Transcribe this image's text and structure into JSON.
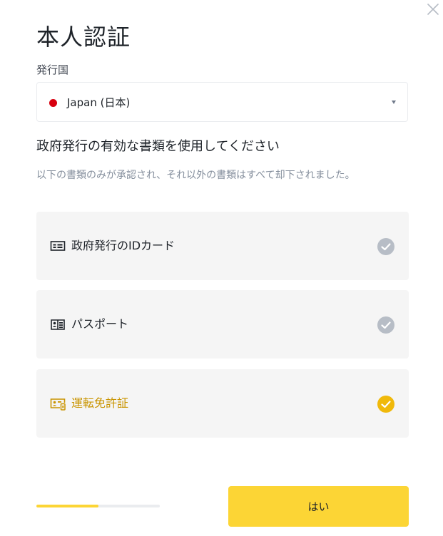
{
  "colors": {
    "accent": "#fcd535",
    "selected_text": "#c99400",
    "check_inactive": "#b7bdc6",
    "check_active": "#f0b90b",
    "flag_japan": "#d7000f",
    "option_bg": "#f5f5f5"
  },
  "dialog": {
    "title": "本人認証",
    "close_icon": "close-icon"
  },
  "issuing_country": {
    "label": "発行国",
    "value": "Japan (日本)",
    "flag_icon": "japan-flag-dot-icon",
    "arrow_icon": "caret-down-icon"
  },
  "documents": {
    "heading": "政府発行の有効な書類を使用してください",
    "description": "以下の書類のみが承認され、それ以外の書類はすべて却下されました。",
    "options": [
      {
        "label": "政府発行のIDカード",
        "icon": "id-card-icon",
        "selected": false
      },
      {
        "label": "パスポート",
        "icon": "passport-icon",
        "selected": false
      },
      {
        "label": "運転免許証",
        "icon": "drivers-license-icon",
        "selected": true
      }
    ]
  },
  "footer": {
    "progress_fraction": 0.5,
    "confirm_label": "はい"
  }
}
